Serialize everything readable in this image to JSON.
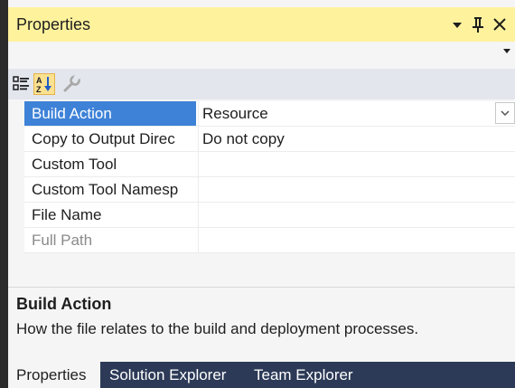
{
  "window": {
    "title": "Properties"
  },
  "toolbar": {
    "categorized_icon": "categorized-icon",
    "alphabetical_icon": "alphabetical-sort-icon",
    "property_pages_icon": "wrench-icon"
  },
  "properties": [
    {
      "name": "Build Action",
      "value": "Resource"
    },
    {
      "name": "Copy to Output Direc",
      "value": "Do not copy"
    },
    {
      "name": "Custom Tool",
      "value": ""
    },
    {
      "name": "Custom Tool Namesp",
      "value": ""
    },
    {
      "name": "File Name",
      "value": ""
    },
    {
      "name": "Full Path",
      "value": ""
    }
  ],
  "description": {
    "title": "Build Action",
    "text": "How the file relates to the build and deployment processes."
  },
  "tabs": [
    {
      "label": "Properties"
    },
    {
      "label": "Solution Explorer"
    },
    {
      "label": "Team Explorer"
    }
  ],
  "colors": {
    "title_bar": "#fff29d",
    "selection": "#3e82d8",
    "tab_strip": "#2c3a57"
  }
}
